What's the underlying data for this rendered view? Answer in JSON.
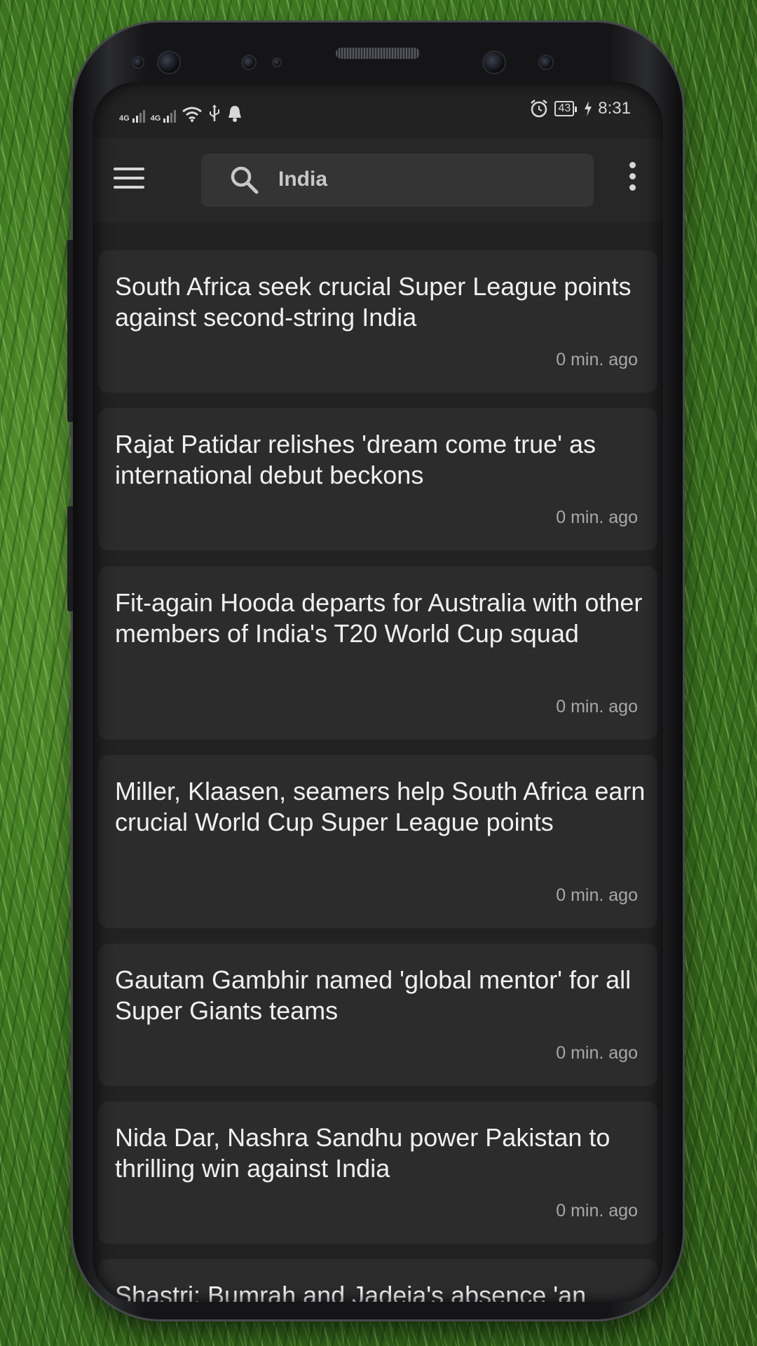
{
  "status_bar": {
    "network_1": "4G",
    "network_2": "4G",
    "battery": "43",
    "time": "8:31",
    "icons": [
      "wifi-icon",
      "usb-icon",
      "bell-icon",
      "alarm-icon",
      "charging-icon"
    ]
  },
  "app_bar": {
    "menu_icon": "hamburger-menu-icon",
    "search_query": "India",
    "more_icon": "overflow-menu-icon"
  },
  "articles": [
    {
      "title": "South Africa seek crucial Super League points against second-string India",
      "time": "0 min. ago"
    },
    {
      "title": "Rajat Patidar relishes 'dream come true' as international debut beckons",
      "time": "0 min. ago"
    },
    {
      "title": "Fit-again Hooda departs for Australia with other members of India's T20 World Cup squad",
      "time": "0 min. ago"
    },
    {
      "title": "Miller, Klaasen, seamers help South Africa earn crucial World Cup Super League points",
      "time": "0 min. ago"
    },
    {
      "title": "Gautam Gambhir named 'global mentor' for all Super Giants teams",
      "time": "0 min. ago"
    },
    {
      "title": "Nida Dar, Nashra Sandhu power Pakistan to thrilling win against India",
      "time": "0 min. ago"
    },
    {
      "title": "Shastri: Bumrah and Jadeja's absence 'an",
      "time": ""
    }
  ],
  "colors": {
    "screen_bg": "#222223",
    "card_bg": "#2c2c2d",
    "title_text": "#f0f0f0",
    "time_text": "#a8a8a8"
  }
}
